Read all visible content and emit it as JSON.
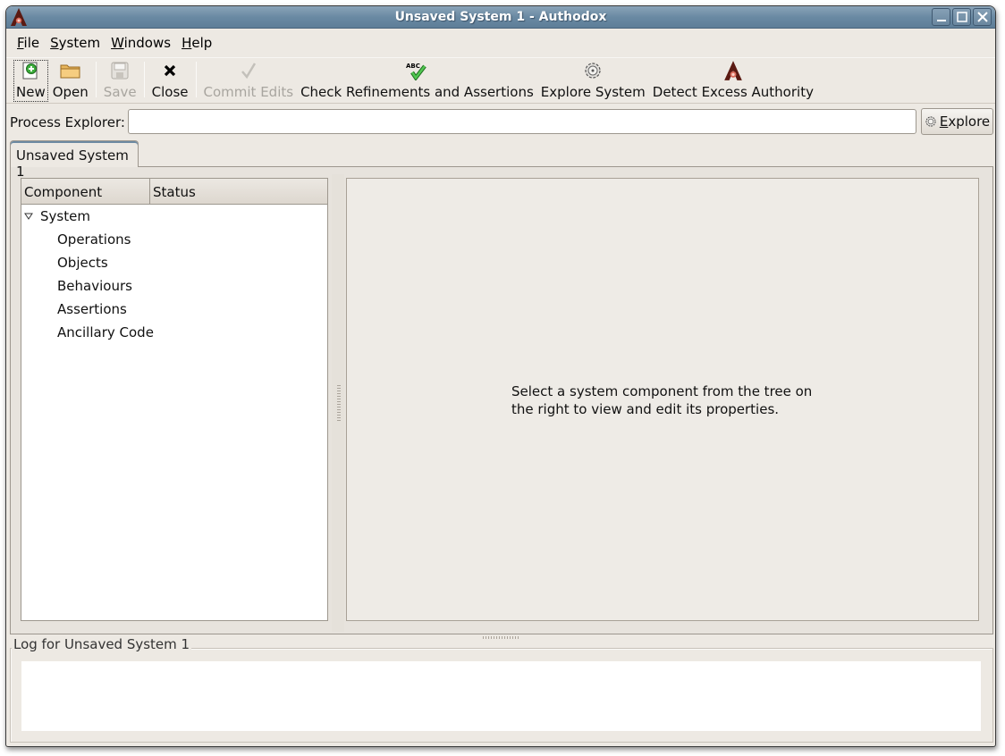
{
  "window": {
    "title": "Unsaved System 1 - Authodox",
    "controls": [
      "minimize",
      "maximize",
      "close"
    ]
  },
  "menubar": {
    "items": [
      {
        "label": "File",
        "mnemonic": "F",
        "rest": "ile"
      },
      {
        "label": "System",
        "mnemonic": "S",
        "rest": "ystem"
      },
      {
        "label": "Windows",
        "mnemonic": "W",
        "rest": "indows"
      },
      {
        "label": "Help",
        "mnemonic": "H",
        "rest": "elp"
      }
    ]
  },
  "toolbar": {
    "new_label": "New",
    "open_label": "Open",
    "save_label": "Save",
    "close_label": "Close",
    "commit_label": "Commit Edits",
    "check_label": "Check Refinements and Assertions",
    "explore_label": "Explore System",
    "detect_label": "Detect Excess Authority",
    "check_icon_text": "ABC"
  },
  "process_explorer": {
    "label": "Process Explorer:",
    "value": "",
    "button_mnemonic": "E",
    "button_rest": "xplore"
  },
  "tabs": [
    {
      "label": "Unsaved System 1",
      "active": true
    }
  ],
  "tree": {
    "columns": [
      "Component",
      "Status"
    ],
    "root": {
      "label": "System",
      "expanded": true
    },
    "children": [
      "Operations",
      "Objects",
      "Behaviours",
      "Assertions",
      "Ancillary Code"
    ]
  },
  "properties": {
    "hint": "Select a system component from the tree on the right to view and edit its properties."
  },
  "log": {
    "title": "Log for Unsaved System 1",
    "content": ""
  },
  "colors": {
    "titlebar": "#6a8aa3",
    "window_bg": "#ede9e3",
    "logo_red": "#7a1f14"
  }
}
